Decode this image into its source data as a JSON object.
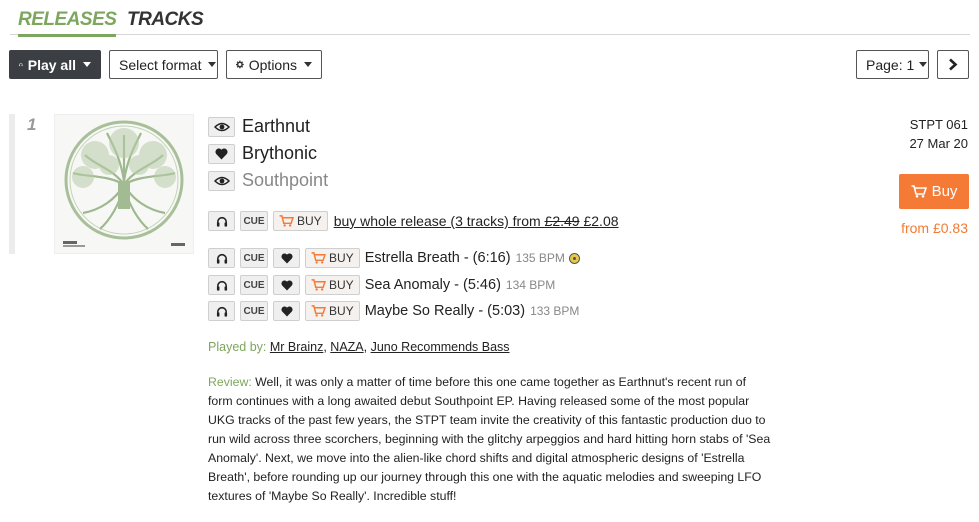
{
  "tabs": {
    "releases": "RELEASES",
    "tracks": "TRACKS"
  },
  "toolbar": {
    "play_all": "Play all",
    "select_format": "Select format",
    "options": "Options",
    "page": "Page: 1"
  },
  "release": {
    "number": "1",
    "artist": "Earthnut",
    "title": "Brythonic",
    "label": "Southpoint",
    "cat_no": "STPT 061",
    "date": "27 Mar 20",
    "buy_label": "Buy",
    "from_price": "from £0.83",
    "cue_label": "CUE",
    "buy_small": "BUY",
    "buy_whole_text": "buy whole release (3 tracks) from ",
    "old_price": "£2.49",
    "new_price": "£2.08",
    "tracks": [
      {
        "title": "Estrella Breath - (6:16)",
        "bpm": "135 BPM"
      },
      {
        "title": "Sea Anomaly - (5:46)",
        "bpm": "134 BPM"
      },
      {
        "title": "Maybe So Really - (5:03)",
        "bpm": "133 BPM"
      }
    ],
    "played_by_label": "Played by:",
    "played_by": [
      "Mr Brainz",
      "NAZA",
      "Juno Recommends Bass"
    ],
    "review_label": "Review:",
    "review_text": "Well, it was only a matter of time before this one came together as Earthnut's recent run of form continues with a long awaited debut Southpoint EP. Having released some of the most popular UKG tracks of the past few years, the STPT team invite the creativity of this fantastic production duo to run wild across three scorchers, beginning with the glitchy arpeggios and hard hitting horn stabs of 'Sea Anomaly'. Next, we move into the alien-like chord shifts and digital atmospheric designs of 'Estrella Breath', before rounding up our journey through this one with the aquatic melodies and sweeping LFO textures of 'Maybe So Really'. Incredible stuff!"
  },
  "colors": {
    "accent_green": "#7da65e",
    "buy_orange": "#f47a35",
    "dark_button": "#3b3f44"
  },
  "icons": [
    "headphones-icon",
    "caret-down-icon",
    "gear-icon",
    "chevron-right-icon",
    "eye-icon",
    "heart-icon",
    "cart-icon",
    "tree-of-life-artwork",
    "disc-icon"
  ]
}
